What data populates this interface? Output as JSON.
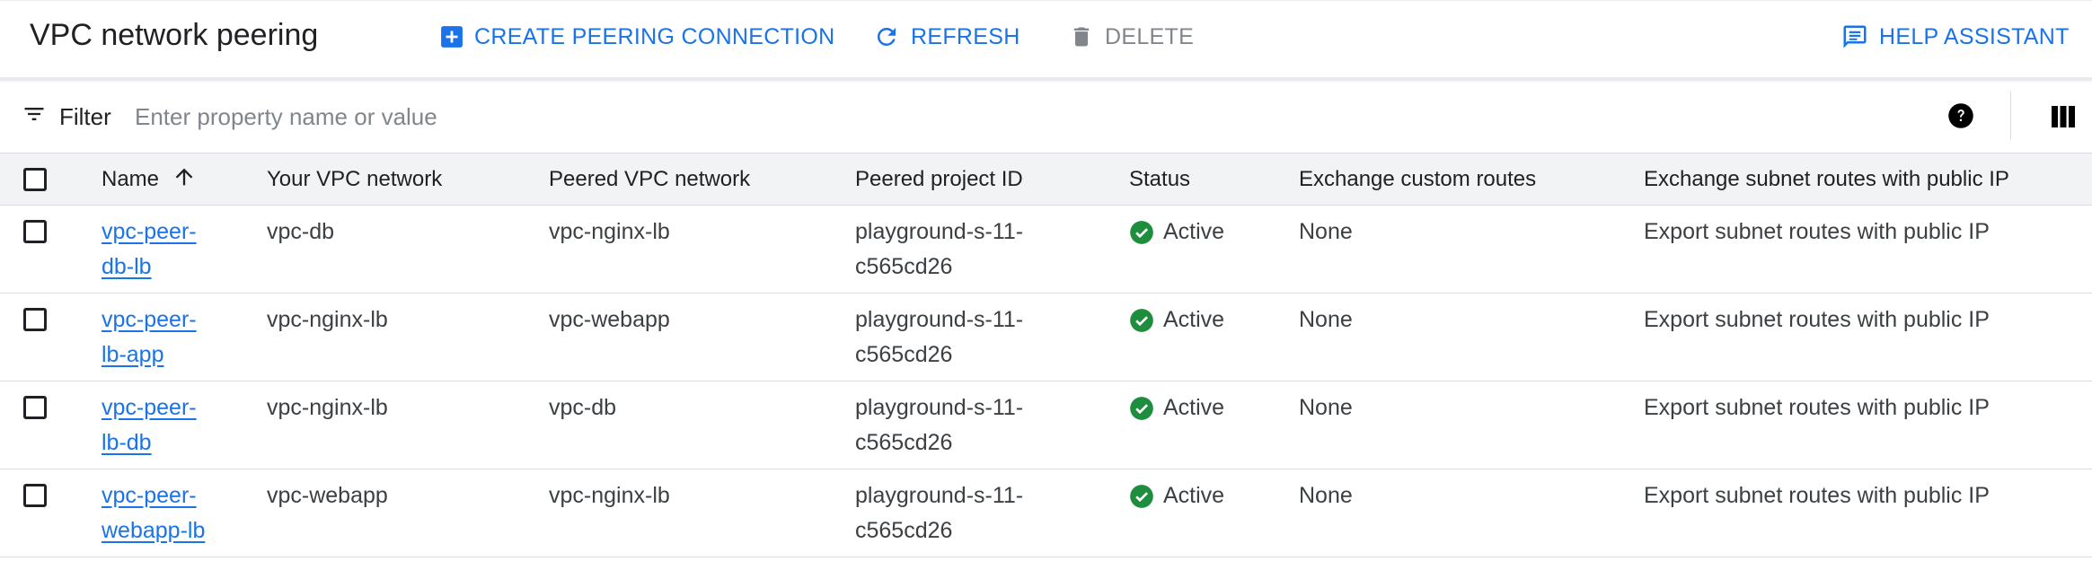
{
  "header": {
    "title": "VPC network peering",
    "create_label": "CREATE PEERING CONNECTION",
    "refresh_label": "REFRESH",
    "delete_label": "DELETE",
    "help_label": "HELP ASSISTANT"
  },
  "filter": {
    "label": "Filter",
    "placeholder": "Enter property name or value",
    "value": ""
  },
  "table": {
    "headers": {
      "name": "Name",
      "your_vpc": "Your VPC network",
      "peered_vpc": "Peered VPC network",
      "peered_project": "Peered project ID",
      "status": "Status",
      "exchange_custom": "Exchange custom routes",
      "exchange_subnet": "Exchange subnet routes with public IP"
    },
    "sort": {
      "column": "Name",
      "direction": "ascending"
    },
    "rows": [
      {
        "name_line1": "vpc-peer-",
        "name_line2": "db-lb",
        "your_vpc": "vpc-db",
        "peered_vpc": "vpc-nginx-lb",
        "project_line1": "playground-s-11-",
        "project_line2": "c565cd26",
        "status": "Active",
        "exchange_custom": "None",
        "exchange_subnet": "Export subnet routes with public IP"
      },
      {
        "name_line1": "vpc-peer-",
        "name_line2": "lb-app",
        "your_vpc": "vpc-nginx-lb",
        "peered_vpc": "vpc-webapp",
        "project_line1": "playground-s-11-",
        "project_line2": "c565cd26",
        "status": "Active",
        "exchange_custom": "None",
        "exchange_subnet": "Export subnet routes with public IP"
      },
      {
        "name_line1": "vpc-peer-",
        "name_line2": "lb-db",
        "your_vpc": "vpc-nginx-lb",
        "peered_vpc": "vpc-db",
        "project_line1": "playground-s-11-",
        "project_line2": "c565cd26",
        "status": "Active",
        "exchange_custom": "None",
        "exchange_subnet": "Export subnet routes with public IP"
      },
      {
        "name_line1": "vpc-peer-",
        "name_line2": "webapp-lb",
        "your_vpc": "vpc-webapp",
        "peered_vpc": "vpc-nginx-lb",
        "project_line1": "playground-s-11-",
        "project_line2": "c565cd26",
        "status": "Active",
        "exchange_custom": "None",
        "exchange_subnet": "Export subnet routes with public IP"
      }
    ]
  },
  "icons": {
    "create": "add-box-icon",
    "refresh": "refresh-icon",
    "delete": "trash-icon",
    "help": "feedback-icon",
    "filter": "filter-list-icon",
    "help_circle": "help-circle-icon",
    "columns": "column-display-icon",
    "sort": "arrow-up-icon",
    "status": "check-circle-icon"
  },
  "colors": {
    "accent": "#1a73e8",
    "disabled": "#80868b",
    "status_active": "#1e8e3e",
    "header_bg": "#f1f3f4"
  }
}
